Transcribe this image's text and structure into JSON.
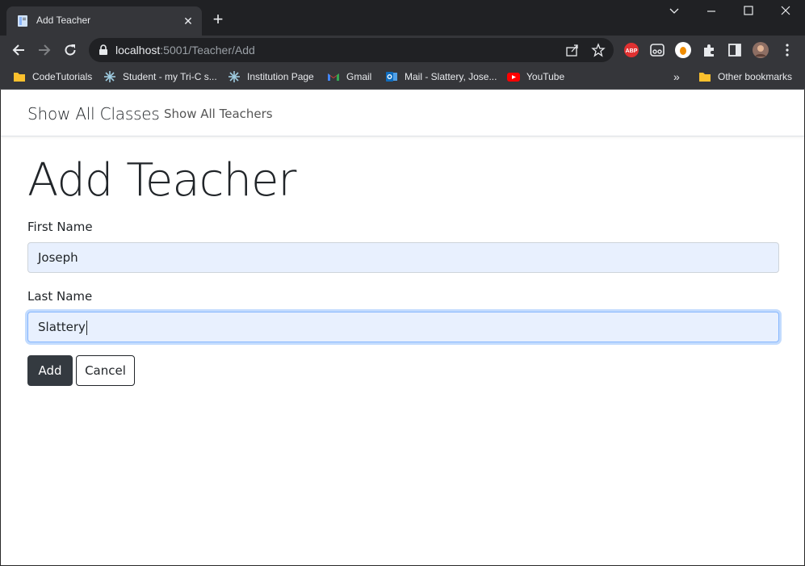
{
  "browser": {
    "tab_title": "Add Teacher",
    "url_host": "localhost",
    "url_path": ":5001/Teacher/Add",
    "bookmarks": [
      {
        "label": "CodeTutorials",
        "icon": "folder-icon"
      },
      {
        "label": "Student - my Tri-C s...",
        "icon": "snowflake-icon"
      },
      {
        "label": "Institution Page",
        "icon": "snowflake-icon"
      },
      {
        "label": "Gmail",
        "icon": "gmail-icon"
      },
      {
        "label": "Mail - Slattery, Jose...",
        "icon": "outlook-icon"
      },
      {
        "label": "YouTube",
        "icon": "youtube-icon"
      }
    ],
    "overflow_label": "»",
    "other_bookmarks": "Other bookmarks",
    "extension_abp": "ABP"
  },
  "nav": {
    "brand": "Show All Classes",
    "link": "Show All Teachers"
  },
  "form": {
    "title": "Add Teacher",
    "first_name_label": "First Name",
    "first_name_value": "Joseph",
    "last_name_label": "Last Name",
    "last_name_value": "Slattery",
    "add_button": "Add",
    "cancel_button": "Cancel"
  }
}
